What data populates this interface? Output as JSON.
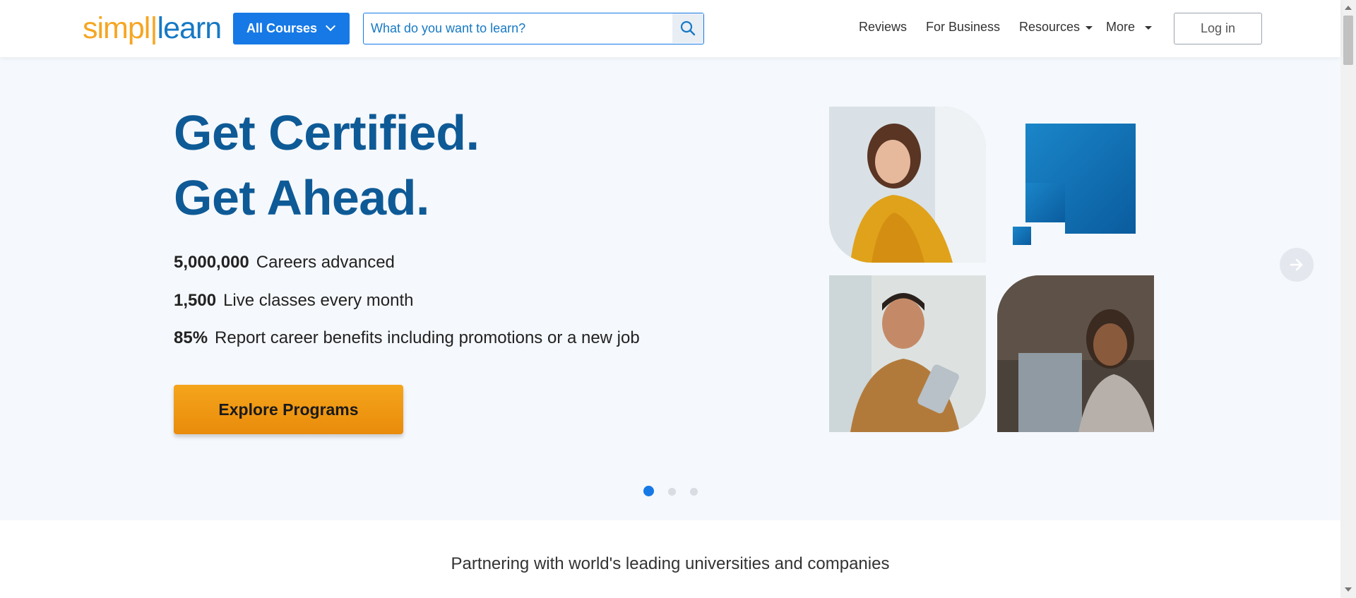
{
  "header": {
    "logo": {
      "part1": "simpl",
      "part2": "|",
      "part3": "learn"
    },
    "all_courses_label": "All Courses",
    "search_placeholder": "What do you want to learn?",
    "nav": {
      "reviews": "Reviews",
      "for_business": "For Business",
      "resources": "Resources",
      "more": "More"
    },
    "login_label": "Log in"
  },
  "hero": {
    "headline_line1": "Get Certified.",
    "headline_line2": "Get Ahead.",
    "stats": [
      {
        "value": "5,000,000",
        "text": "Careers advanced"
      },
      {
        "value": "1,500",
        "text": "Live classes every month"
      },
      {
        "value": "85%",
        "text": "Report career benefits including promotions or a new job"
      }
    ],
    "cta_label": "Explore Programs",
    "carousel": {
      "total": 3,
      "active": 1
    }
  },
  "partners": {
    "heading": "Partnering with world's leading universities and companies"
  },
  "colors": {
    "brand_blue": "#1679e6",
    "headline_blue": "#0e5a96",
    "cta_orange": "#f39c12",
    "logo_orange": "#f5a623"
  },
  "icons": [
    "search-icon",
    "chevron-down-icon",
    "caret-down-icon",
    "arrow-right-icon",
    "blue-staircase-graphic"
  ]
}
